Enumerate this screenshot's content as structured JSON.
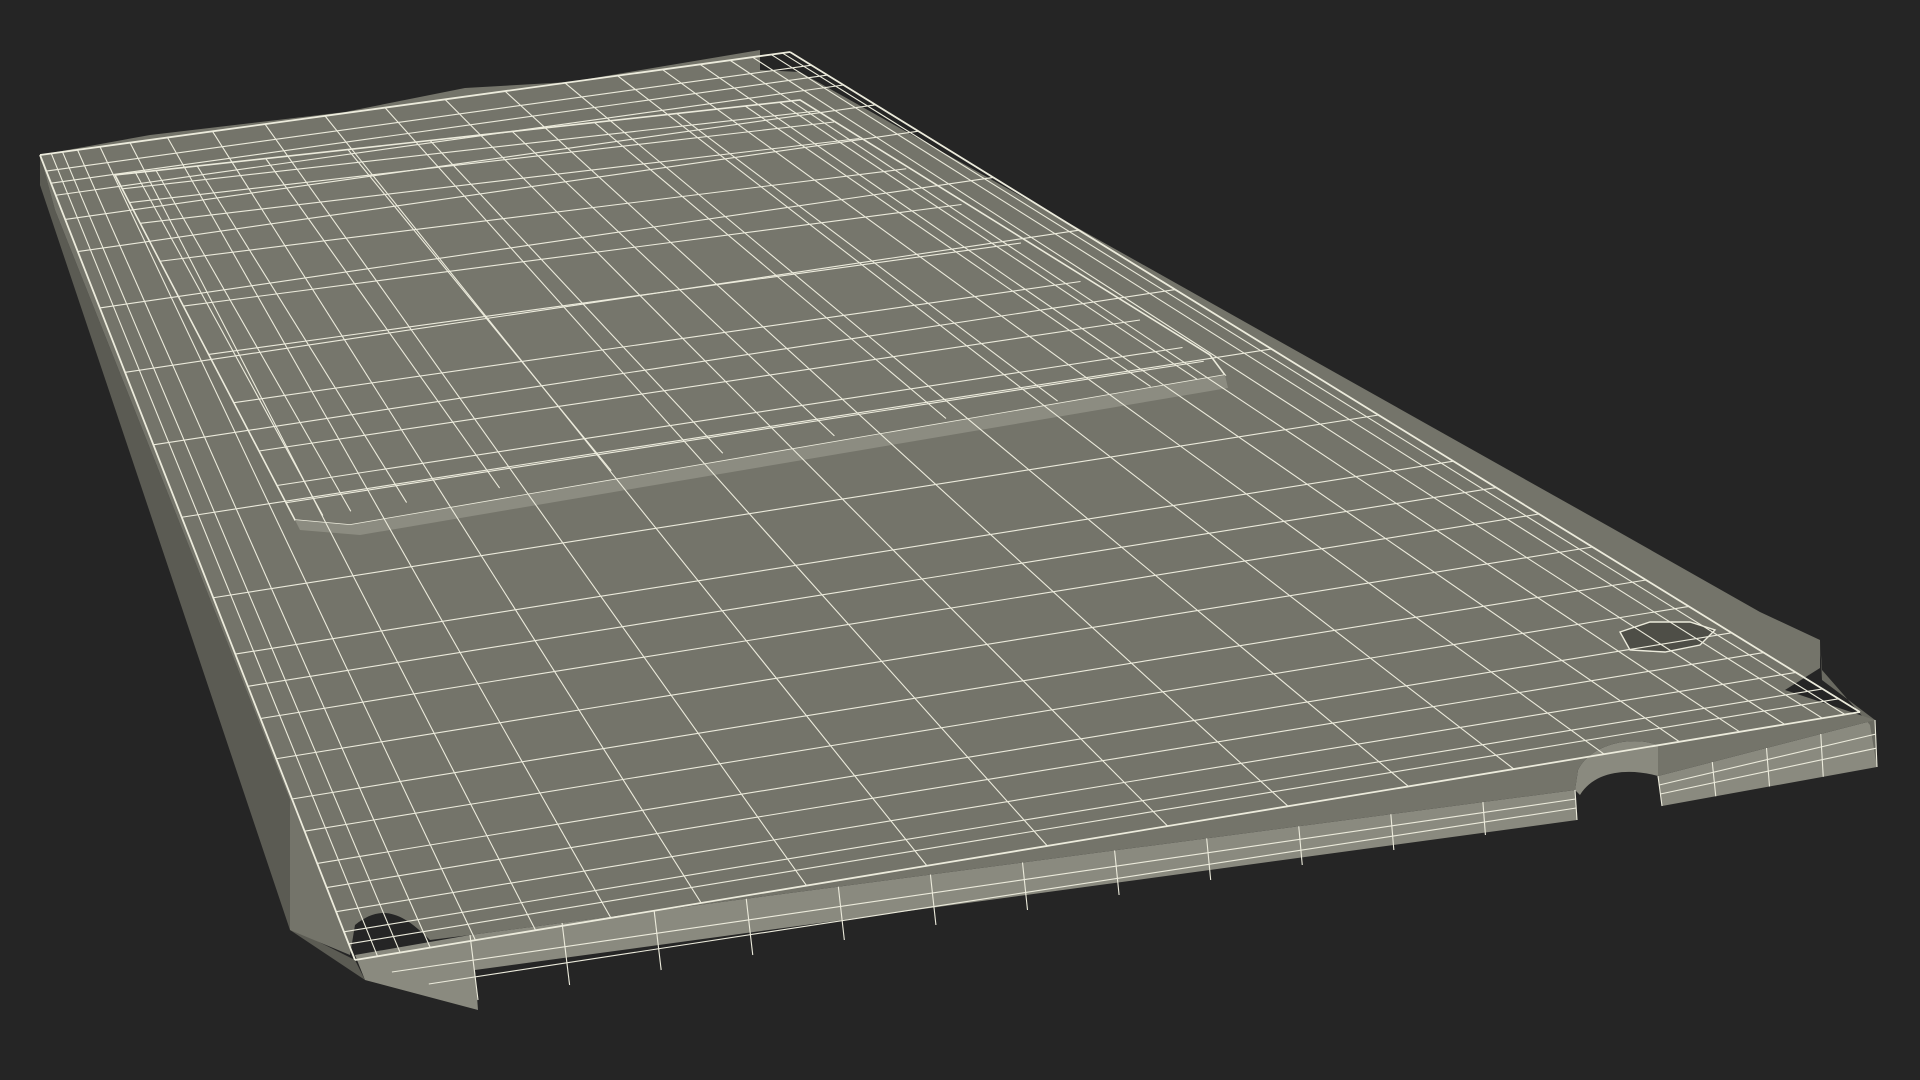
{
  "scene": {
    "background_color": "#252525",
    "surface_color": "#74746a",
    "side_color": "#8a8a7f",
    "wire_color": "#ecebdc",
    "object": "wireframe-3d-model",
    "render_mode": "wireframe-on-shaded"
  }
}
